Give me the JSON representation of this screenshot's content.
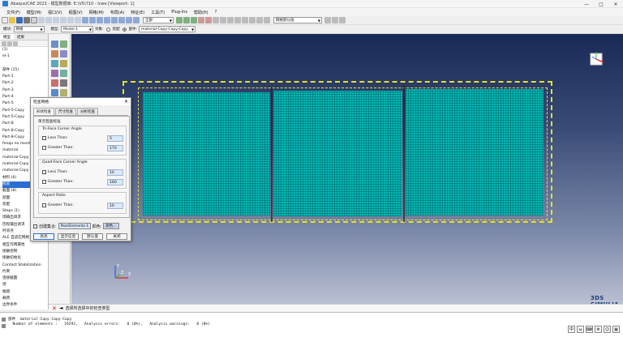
{
  "window": {
    "title": "Abaqus/CAE 2023 - 模型数据库: E:\\V5\\710 - lcwe [Viewport: 1]",
    "controls": [
      "—",
      "□",
      "✕"
    ]
  },
  "menu": [
    "文件(F)",
    "模型(M)",
    "视口(V)",
    "视图(V)",
    "网格(M)",
    "布局(A)",
    "特征(E)",
    "工具(T)",
    "Plug-ins",
    "帮助(H)",
    "?"
  ],
  "toolbar1": {
    "render_combo": "全部",
    "display_combo": "网格默认值"
  },
  "toolbar2": {
    "module_label": "模块:",
    "module_value": "网格",
    "model_label": "模型:",
    "model_value": "Model-1",
    "object_label": "对象:",
    "radio_assembly": "装配",
    "radio_part": "部件:",
    "part_value": "material-Copy-Copy-Copy"
  },
  "leftpanel": {
    "tabs": [
      "模型",
      "结果"
    ],
    "tree": [
      "(1)",
      "el-1",
      "",
      "部件 (15)",
      "Part-1",
      "Part-2",
      "Part-3",
      "Part-4",
      "Part-5",
      "Part-5-Copy",
      "Part-5-Copy",
      "Part-8",
      "Part-8-Copy",
      "Part-8-Copy",
      "fenqu no mesh",
      "material",
      "material-Copy",
      "material-Copy",
      "material-Copy",
      "材料 (6)",
      "校验",
      "截面 (8)",
      "剖面",
      "装配",
      "Steps (1)",
      "场输出请求",
      "历程输出请求",
      "时间点",
      "ALE 自适应网格",
      "相互作用属性",
      "接触控制",
      "接触初始化",
      "Contact Stabilization",
      "约束",
      "连接截面",
      "场",
      "幅值",
      "载荷",
      "边界条件"
    ],
    "selected_index": 20
  },
  "dialog": {
    "title": "检查网格",
    "tabs": [
      "形状检查",
      "尺寸检查",
      "分析检查"
    ],
    "section_title": "单元检查标准",
    "tri_title": "Tri-Face Corner Angle",
    "tri_less_label": "Less Than:",
    "tri_less_value": "5",
    "tri_greater_label": "Greater Than:",
    "tri_greater_value": "170",
    "quad_title": "Quad-Face Corner Angle",
    "quad_less_label": "Less Than:",
    "quad_less_value": "10",
    "quad_greater_label": "Greater Than:",
    "quad_greater_value": "160",
    "aspect_title": "Aspect Ratio",
    "aspect_greater_label": "Greater Than:",
    "aspect_greater_value": "10",
    "save_label": "创建集合:",
    "save_set_value": "PoorElements-1",
    "color_label": "颜色:",
    "color_value": "颜色...",
    "buttons": [
      "高亮",
      "显示信息",
      "默认值",
      "关闭"
    ]
  },
  "prompt": {
    "text": "选择所选择中的检查类型"
  },
  "messages": {
    "lines": [
      "部件  material-Copy-Copy-Copy",
      "  Number of elements :   19292,   Analysis errors:   0 (0%),   Analysis warnings:   0 (0%)"
    ]
  },
  "brand": "3DS SIMULIA",
  "triad": {
    "x": "X",
    "y": "Y",
    "z": "Z"
  },
  "colors": {
    "mesh": "#00b6b2",
    "outline": "#e6e221",
    "viewport_top": "#1a2a57",
    "viewport_bottom": "#b9c0d3",
    "selection": "#2a6fd1"
  }
}
